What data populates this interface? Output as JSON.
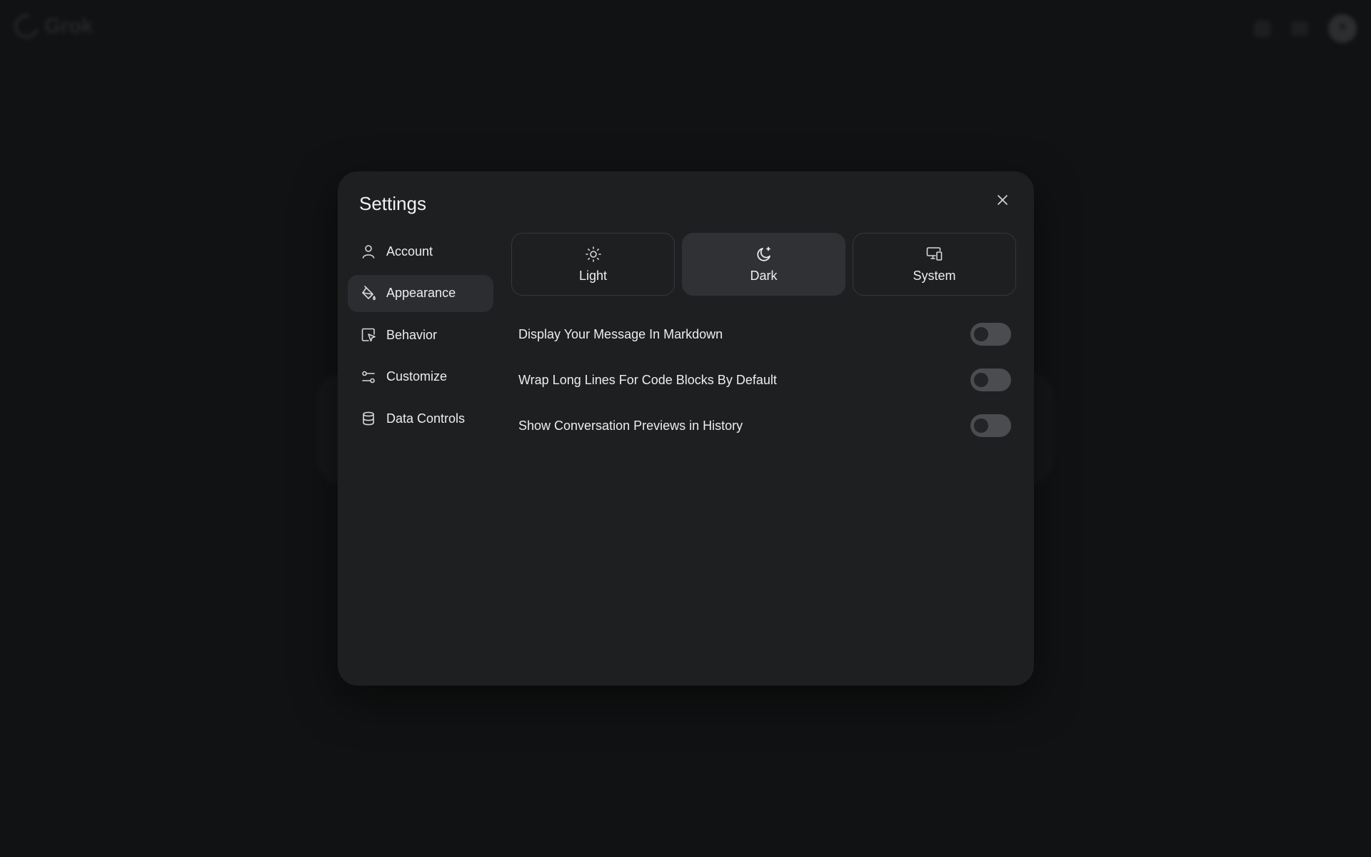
{
  "background_app": {
    "brand": "Grok"
  },
  "settings": {
    "title": "Settings",
    "nav": [
      {
        "label": "Account",
        "icon": "user-icon",
        "active": false
      },
      {
        "label": "Appearance",
        "icon": "paint-bucket-icon",
        "active": true
      },
      {
        "label": "Behavior",
        "icon": "cursor-window-icon",
        "active": false
      },
      {
        "label": "Customize",
        "icon": "sliders-icon",
        "active": false
      },
      {
        "label": "Data Controls",
        "icon": "database-icon",
        "active": false
      }
    ],
    "themes": [
      {
        "label": "Light",
        "icon": "sun-icon",
        "selected": false
      },
      {
        "label": "Dark",
        "icon": "moon-icon",
        "selected": true
      },
      {
        "label": "System",
        "icon": "devices-icon",
        "selected": false
      }
    ],
    "toggles": [
      {
        "label": "Display Your Message In Markdown",
        "on": false
      },
      {
        "label": "Wrap Long Lines For Code Blocks By Default",
        "on": false
      },
      {
        "label": "Show Conversation Previews in History",
        "on": false
      }
    ]
  },
  "colors": {
    "page_bg": "#141517",
    "modal_bg": "#1e1f21",
    "active_item_bg": "#2c2d30",
    "toggle_off_bg": "#4a4c50"
  }
}
